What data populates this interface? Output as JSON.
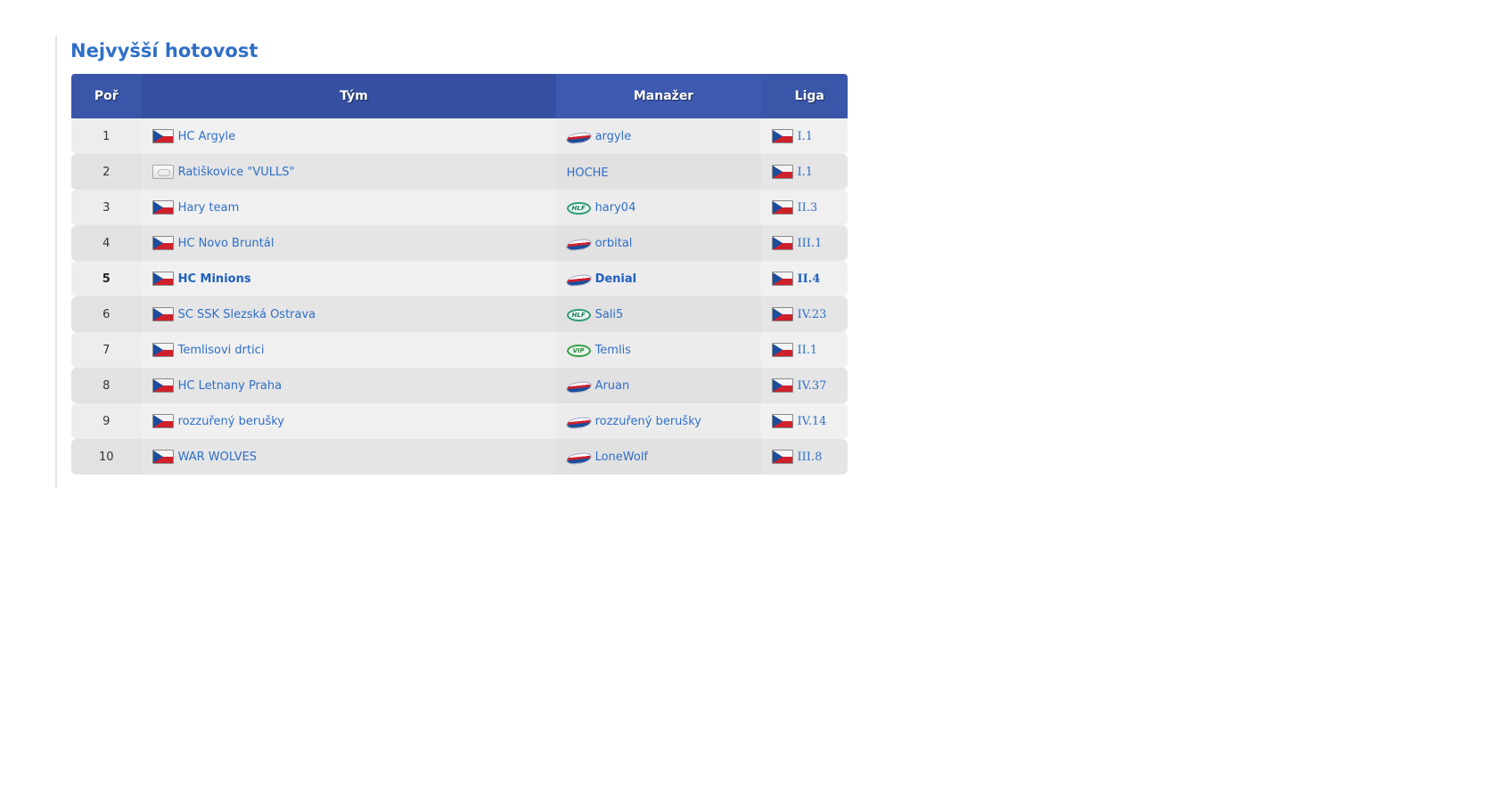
{
  "page": {
    "title": "Nejvyšší hotovost"
  },
  "table": {
    "headers": {
      "rank": "Poř",
      "team": "Tým",
      "manager": "Manažer",
      "league": "Liga"
    },
    "rows": [
      {
        "rank": "1",
        "team": "HC Argyle",
        "team_flag": "cz-flag-icon",
        "manager": "argyle",
        "manager_badge": "stripe-badge-icon",
        "league": "I.1",
        "league_flag": "cz-flag-icon"
      },
      {
        "rank": "2",
        "team": "Ratiškovice \"VULLS\"",
        "team_flag": "blank-flag-icon",
        "manager": "HOCHE",
        "manager_badge": "",
        "league": "I.1",
        "league_flag": "cz-flag-icon"
      },
      {
        "rank": "3",
        "team": "Hary team",
        "team_flag": "cz-flag-icon",
        "manager": "hary04",
        "manager_badge": "hlf-badge-icon",
        "manager_badge_text": "HLF",
        "league": "II.3",
        "league_flag": "cz-flag-icon"
      },
      {
        "rank": "4",
        "team": "HC Novo Bruntál",
        "team_flag": "cz-flag-icon",
        "manager": "orbital",
        "manager_badge": "stripe-badge-icon",
        "league": "III.1",
        "league_flag": "cz-flag-icon"
      },
      {
        "rank": "5",
        "team": "HC Minions",
        "team_flag": "cz-flag-icon",
        "manager": "Denial",
        "manager_badge": "stripe-badge-icon",
        "league": "II.4",
        "league_flag": "cz-flag-icon",
        "highlight": true
      },
      {
        "rank": "6",
        "team": "SC SSK Slezská Ostrava",
        "team_flag": "cz-flag-icon",
        "manager": "Sali5",
        "manager_badge": "hlf-badge-icon",
        "manager_badge_text": "HLF",
        "league": "IV.23",
        "league_flag": "cz-flag-icon"
      },
      {
        "rank": "7",
        "team": "Temlisovi drtici",
        "team_flag": "cz-flag-icon",
        "manager": "Temlis",
        "manager_badge": "vip-badge-icon",
        "manager_badge_text": "VIP",
        "league": "II.1",
        "league_flag": "cz-flag-icon"
      },
      {
        "rank": "8",
        "team": "HC Letnany Praha",
        "team_flag": "cz-flag-icon",
        "manager": "Aruan",
        "manager_badge": "stripe-badge-icon",
        "league": "IV.37",
        "league_flag": "cz-flag-icon"
      },
      {
        "rank": "9",
        "team": "rozzuřený berušky",
        "team_flag": "cz-flag-icon",
        "manager": "rozzuřený berušky",
        "manager_badge": "stripe-badge-icon",
        "league": "IV.14",
        "league_flag": "cz-flag-icon"
      },
      {
        "rank": "10",
        "team": "WAR WOLVES",
        "team_flag": "cz-flag-icon",
        "manager": "LoneWolf",
        "manager_badge": "stripe-badge-icon",
        "league": "III.8",
        "league_flag": "cz-flag-icon"
      }
    ]
  },
  "colors": {
    "header_bg": "#3a56a9",
    "link": "#2f6fc7",
    "row_odd": "#f0f0f0",
    "row_even": "#e5e5e5"
  }
}
